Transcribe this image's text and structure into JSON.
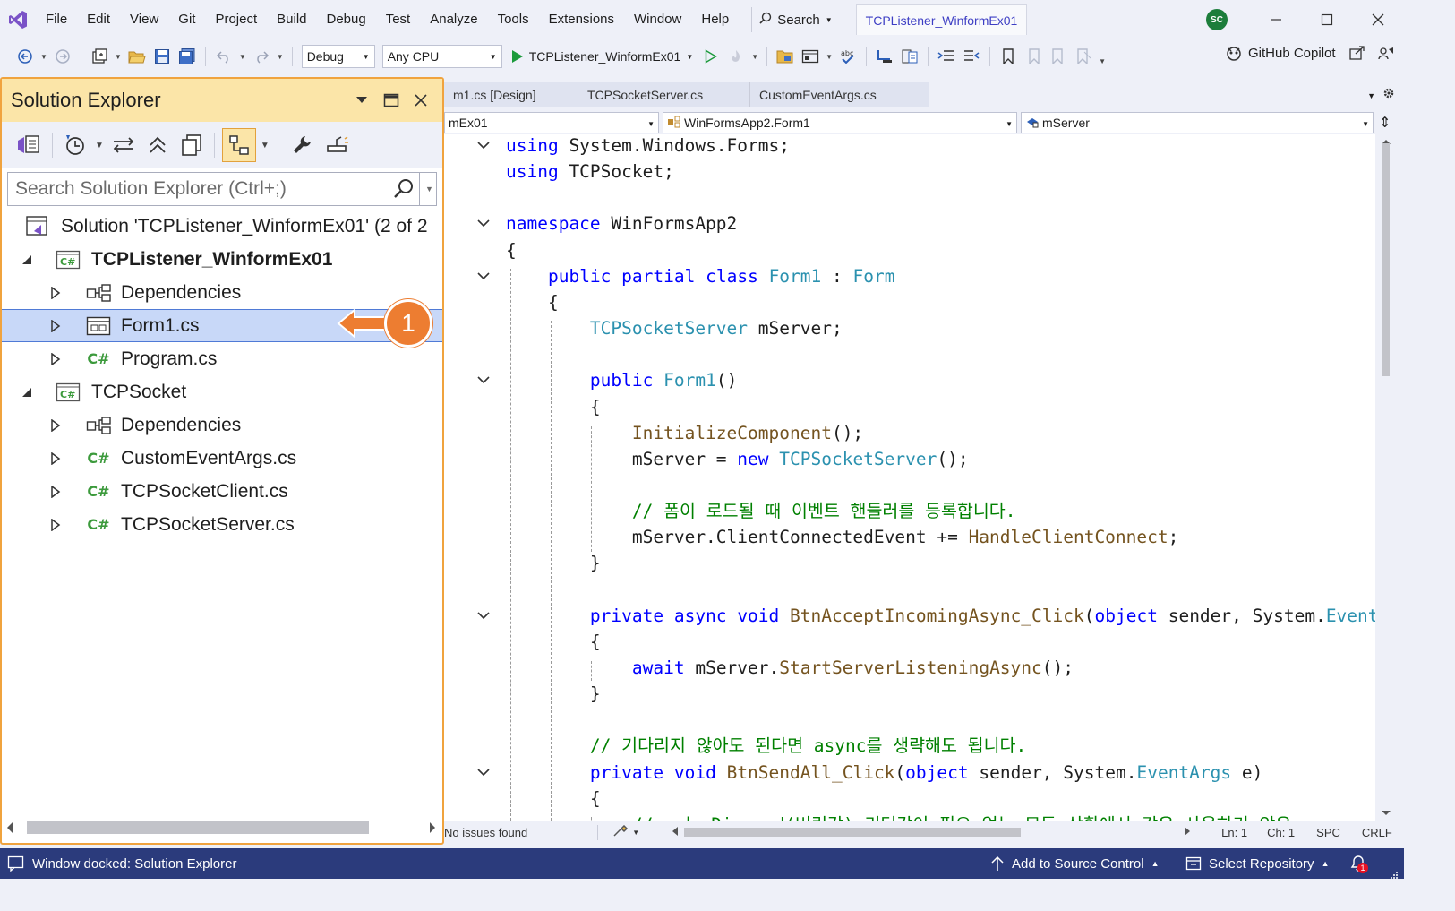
{
  "menubar": {
    "items": [
      "File",
      "Edit",
      "View",
      "Git",
      "Project",
      "Build",
      "Debug",
      "Test",
      "Analyze",
      "Tools",
      "Extensions",
      "Window",
      "Help"
    ],
    "search_label": "Search",
    "solution_title": "TCPListener_WinformEx01",
    "user_initials": "SC"
  },
  "toolbar": {
    "config_value": "Debug",
    "platform_value": "Any CPU",
    "start_label": "TCPListener_WinformEx01",
    "copilot_label": "GitHub Copilot"
  },
  "solution_explorer": {
    "title": "Solution Explorer",
    "search_placeholder": "Search Solution Explorer (Ctrl+;)",
    "tree": [
      {
        "label": "Solution 'TCPListener_WinformEx01' (2 of 2",
        "icon": "solution-icon",
        "bold": false
      },
      {
        "label": "TCPListener_WinformEx01",
        "icon": "csharp-project-icon",
        "bold": true
      },
      {
        "label": "Dependencies",
        "icon": "dependencies-icon"
      },
      {
        "label": "Form1.cs",
        "icon": "form-icon",
        "selected": true
      },
      {
        "label": "Program.cs",
        "icon": "csharp-file-icon"
      },
      {
        "label": "TCPSocket",
        "icon": "csharp-project-icon"
      },
      {
        "label": "Dependencies",
        "icon": "dependencies-icon"
      },
      {
        "label": "CustomEventArgs.cs",
        "icon": "csharp-file-icon"
      },
      {
        "label": "TCPSocketClient.cs",
        "icon": "csharp-file-icon"
      },
      {
        "label": "TCPSocketServer.cs",
        "icon": "csharp-file-icon"
      }
    ],
    "csharp_glyph": "C#",
    "project_glyph": "C#"
  },
  "callout": {
    "number": "1",
    "color": "#ed7d31"
  },
  "editor": {
    "tabs": [
      "m1.cs [Design]",
      "TCPSocketServer.cs",
      "CustomEventArgs.cs"
    ],
    "nav_project": "mEx01",
    "nav_class": "WinFormsApp2.Form1",
    "nav_member": "mServer",
    "code": [
      {
        "t": "kw",
        "a": "using",
        "b": " System.Windows.Forms;"
      },
      {
        "t": "kw",
        "a": "using",
        "b": " TCPSocket;"
      },
      {
        "t": "blank"
      },
      {
        "t": "kw",
        "a": "namespace",
        "b": " WinFormsApp2"
      },
      {
        "t": "plain",
        "b": "{"
      },
      {
        "t": "class"
      },
      {
        "t": "plain",
        "b": "    {"
      },
      {
        "t": "field"
      },
      {
        "t": "blank"
      },
      {
        "t": "ctor"
      },
      {
        "t": "plain",
        "b": "        {"
      },
      {
        "t": "init"
      },
      {
        "t": "assign"
      },
      {
        "t": "blank"
      },
      {
        "t": "comment",
        "b": "            // 폼이 로드될 때 이벤트 핸들러를 등록합니다."
      },
      {
        "t": "event"
      },
      {
        "t": "plain",
        "b": "        }"
      },
      {
        "t": "blank"
      },
      {
        "t": "accept"
      },
      {
        "t": "plain",
        "b": "        {"
      },
      {
        "t": "await"
      },
      {
        "t": "plain",
        "b": "        }"
      },
      {
        "t": "blank"
      },
      {
        "t": "comment",
        "b": "        // 기다리지 않아도 된다면 async를 생략해도 됩니다."
      },
      {
        "t": "sendall"
      },
      {
        "t": "plain",
        "b": "        {"
      },
      {
        "t": "comment",
        "b": "            // _ 는 Discard(버림값) 리턴값이 필요 없는 모든 상황에서 같은 사용하기 않은"
      }
    ],
    "status_issues": "No issues found",
    "ln": "Ln: 1",
    "ch": "Ch: 1",
    "spc": "SPC",
    "eol": "CRLF"
  },
  "statusbar": {
    "message": "Window docked: Solution Explorer",
    "source_control": "Add to Source Control",
    "repository": "Select Repository",
    "notifications": "1"
  },
  "colors": {
    "accent_orange": "#f0a33e",
    "status_blue": "#2b3b7c",
    "keyword": "#0000ff",
    "type": "#2b91af",
    "method": "#74531f",
    "comment": "#008000"
  }
}
